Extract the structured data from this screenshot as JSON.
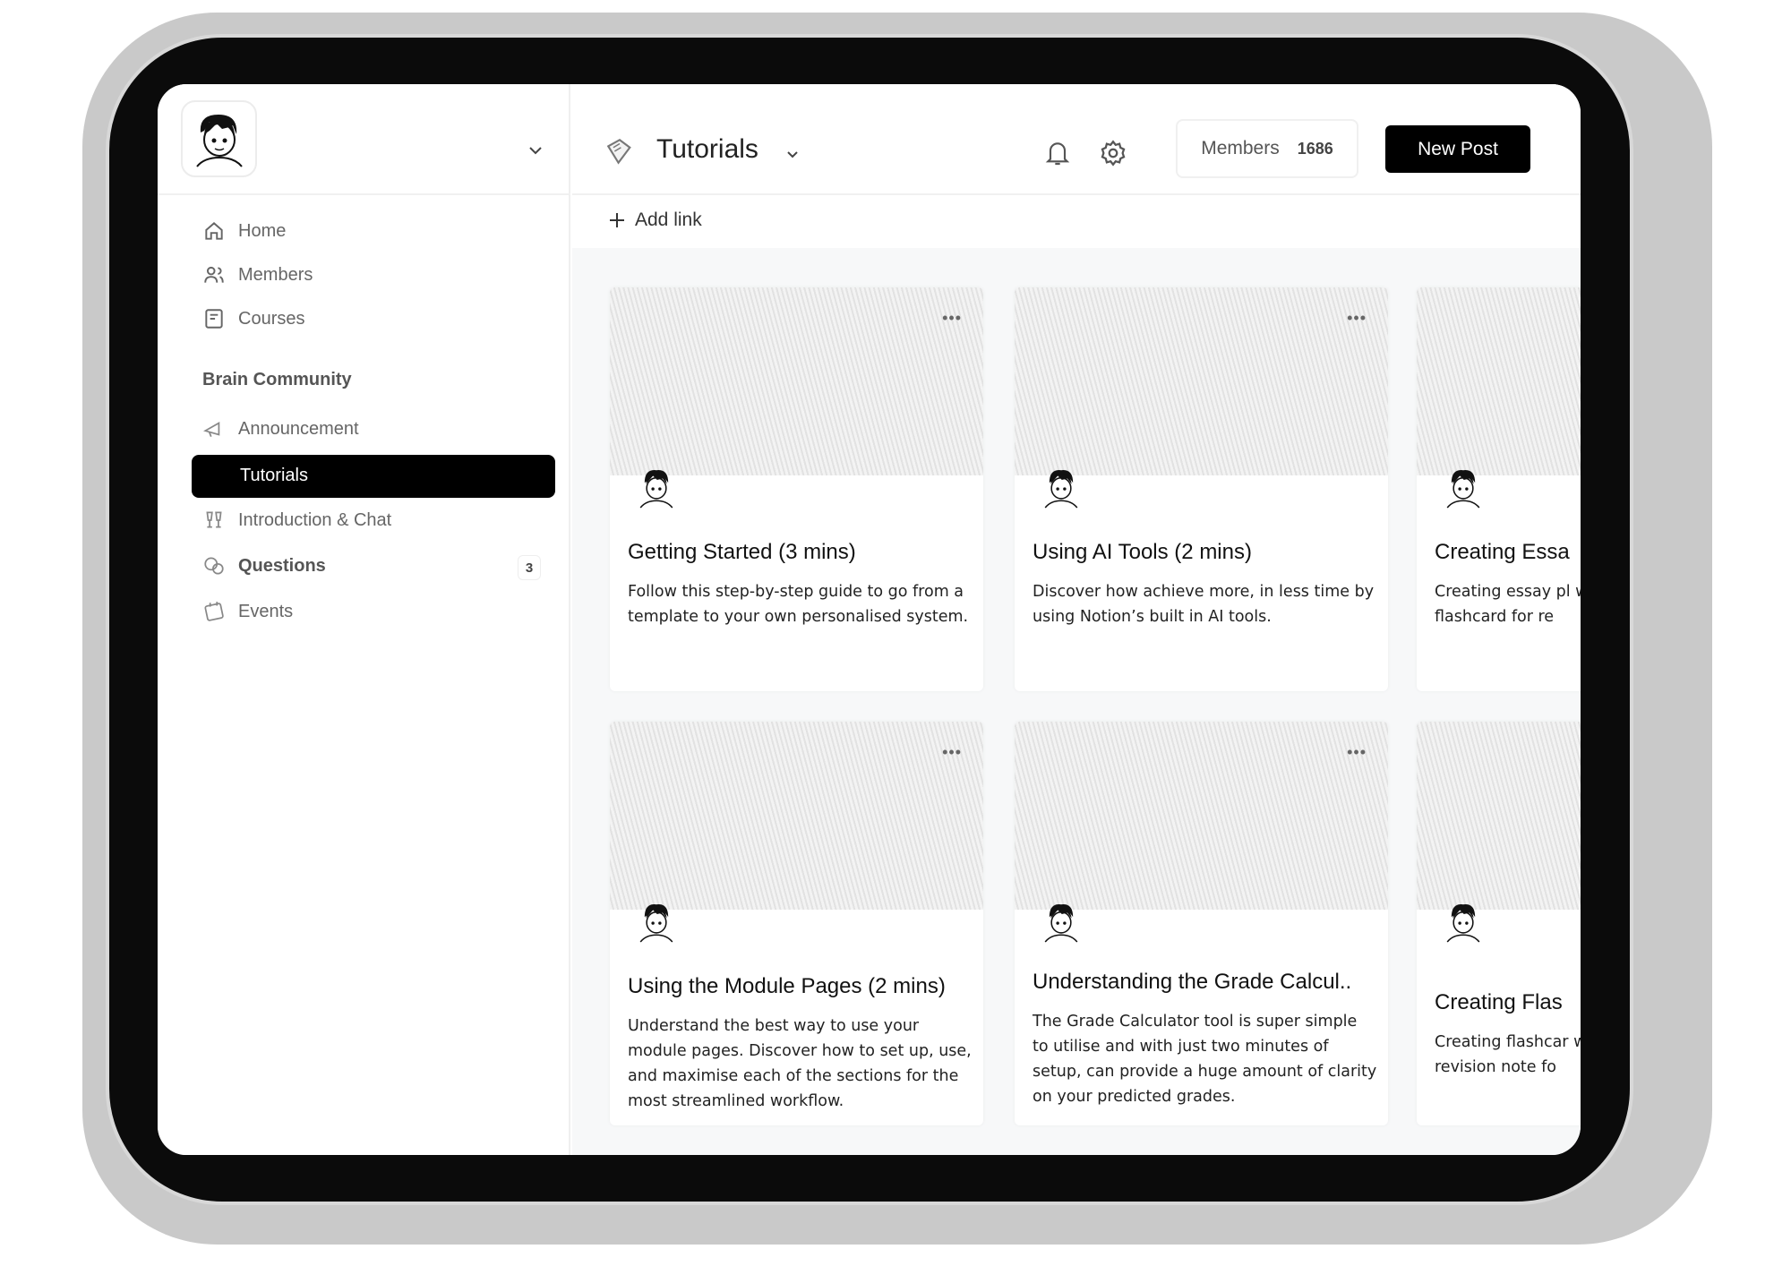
{
  "sidebar": {
    "nav": [
      {
        "label": "Home",
        "icon": "home-icon"
      },
      {
        "label": "Members",
        "icon": "users-icon"
      },
      {
        "label": "Courses",
        "icon": "book-icon"
      }
    ],
    "section_title": "Brain Community",
    "spaces": [
      {
        "label": "Announcement",
        "icon": "megaphone-icon"
      },
      {
        "label": "Tutorials",
        "icon": "book-icon",
        "active": true
      },
      {
        "label": "Introduction & Chat",
        "icon": "cheers-icon"
      },
      {
        "label": "Questions",
        "icon": "chat-bubbles-icon",
        "badge": "3"
      },
      {
        "label": "Events",
        "icon": "calendar-icon"
      }
    ]
  },
  "header": {
    "title": "Tutorials",
    "members_label": "Members",
    "members_count": "1686",
    "new_post": "New Post",
    "add_link": "Add link"
  },
  "cards": [
    {
      "title": "Getting Started (3 mins)",
      "desc": "Follow this step-by-step guide to go from a template to your own personalised system."
    },
    {
      "title": "Using AI Tools (2 mins)",
      "desc": "Discover how achieve more, in less time by using Notion’s built in AI tools."
    },
    {
      "title": "Creating Essa",
      "desc": "Creating essay pl when you duplica a flashcard for re"
    },
    {
      "title": "Using the Module Pages (2 mins)",
      "desc": "Understand the best way to use your module pages. Discover how to set up, use, and maximise each of the sections for the most streamlined workflow."
    },
    {
      "title": "Understanding the Grade Calcul..",
      "desc": "The Grade Calculator tool is super simple to utilise and with just two minutes of setup, can provide a huge amount of clarity on your predicted grades."
    },
    {
      "title": "Creating Flas",
      "desc": "Creating flashcar when you duplica a revision note fo"
    }
  ],
  "colors": {
    "accent": "#000000",
    "content_bg": "#f7f8f9"
  }
}
